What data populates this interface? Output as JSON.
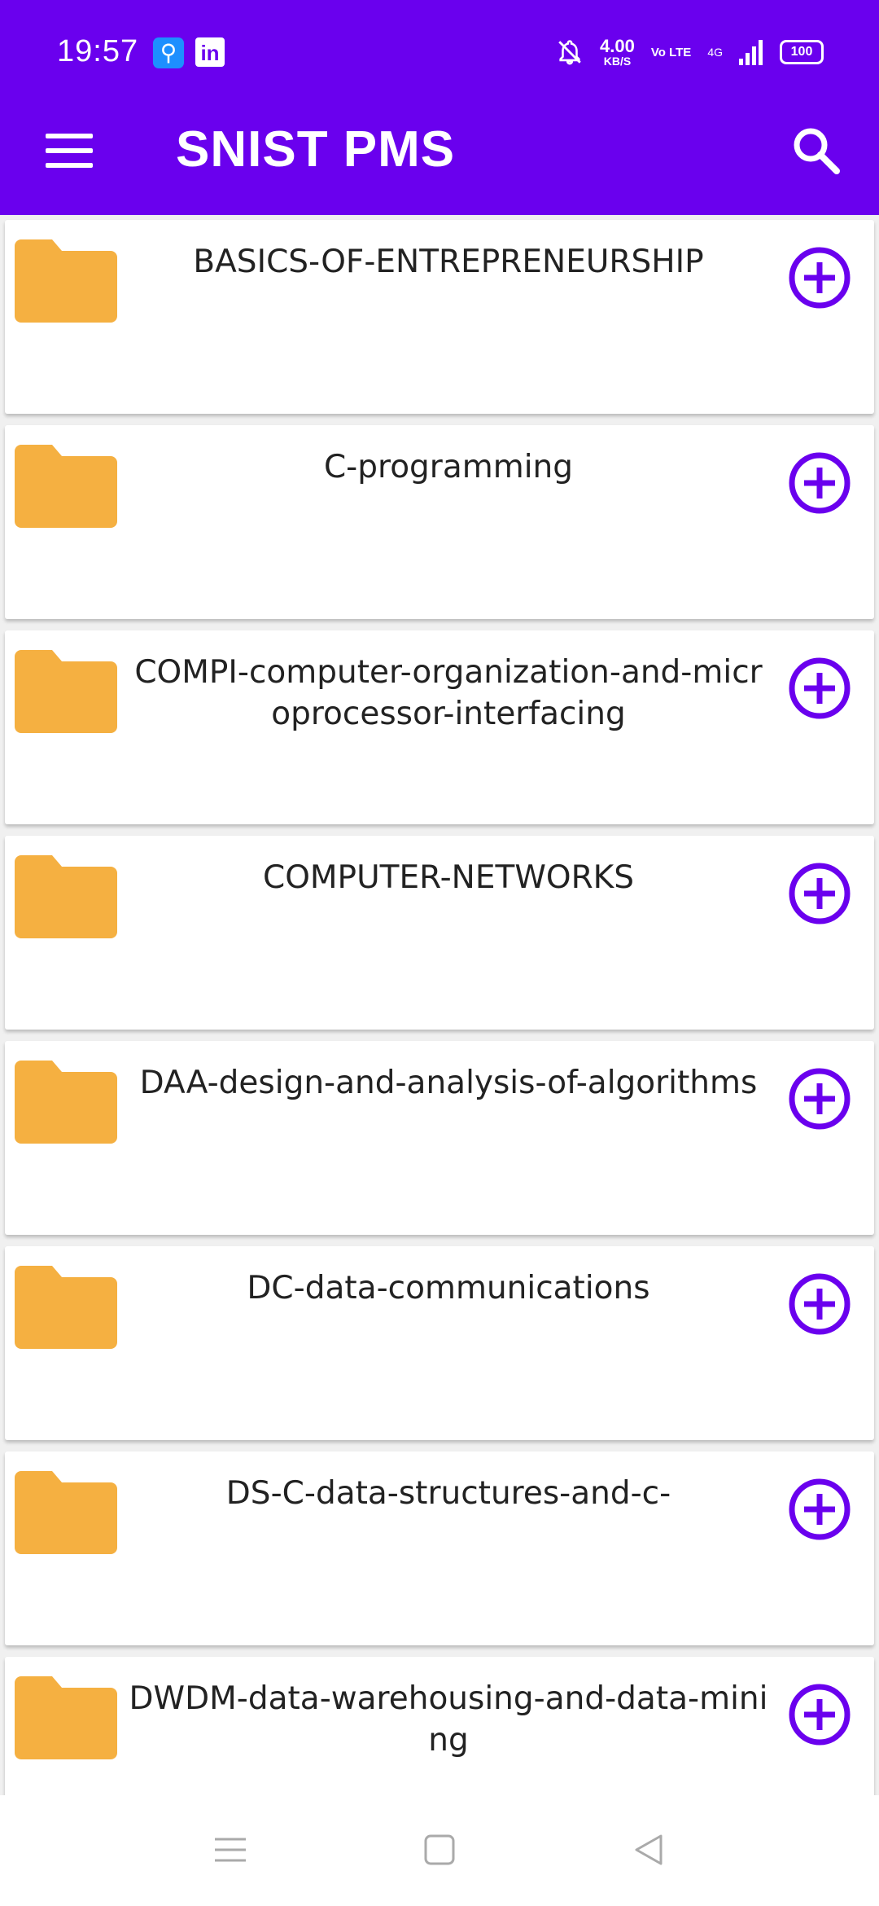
{
  "status_bar": {
    "time": "19:57",
    "usb_icon": "usb-icon",
    "linkedin_text": "in",
    "speed_value": "4.00",
    "speed_unit": "KB/S",
    "volte": "Vo LTE",
    "network": "4G",
    "battery": "100"
  },
  "app_bar": {
    "title": "SNIST PMS",
    "menu_icon": "hamburger-menu-icon",
    "search_icon": "search-icon"
  },
  "folders": [
    {
      "name": "BASICS-OF-ENTREPRENEURSHIP"
    },
    {
      "name": "C-programming"
    },
    {
      "name": "COMPI-computer-organization-and-microprocessor-interfacing"
    },
    {
      "name": "COMPUTER-NETWORKS"
    },
    {
      "name": "DAA-design-and-analysis-of-algorithms"
    },
    {
      "name": "DC-data-communications"
    },
    {
      "name": "DS-C-data-structures-and-c-"
    },
    {
      "name": "DWDM-data-warehousing-and-data-mining"
    }
  ],
  "icons": {
    "folder": "folder-icon",
    "add": "add-circle-icon"
  },
  "colors": {
    "primary": "#6a00ee",
    "folder": "#f5b041",
    "background": "#f0f0f0"
  },
  "navigation_bar": [
    "recent-apps-icon",
    "home-icon",
    "back-icon"
  ]
}
